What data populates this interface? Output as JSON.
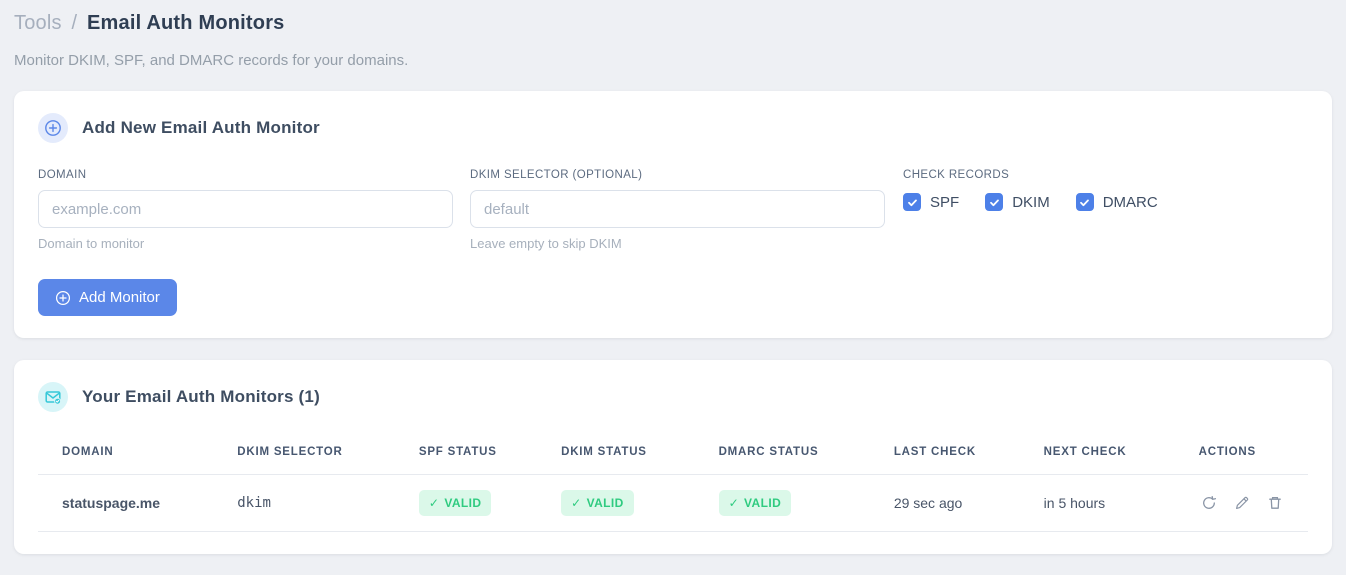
{
  "breadcrumb": {
    "section": "Tools",
    "separator": "/",
    "page": "Email Auth Monitors"
  },
  "subtitle": "Monitor DKIM, SPF, and DMARC records for your domains.",
  "icons": {
    "check_glyph": "✓",
    "header_icon_add": "plus-circle-icon",
    "header_icon_monitors": "mail-check-icon",
    "action_icons": [
      "refresh-icon",
      "edit-pencil-icon",
      "trash-icon"
    ]
  },
  "colors": {
    "accent_blue": "#5b87e8",
    "checkbox_blue": "#4d80e8",
    "badge_green_bg": "#dbf8e9",
    "badge_green_text": "#2fcb80",
    "code_pink": "#e8427c",
    "teal_icon": "#35c8d8",
    "page_bg": "#eef0f4"
  },
  "add_card": {
    "title": "Add New Email Auth Monitor",
    "fields": {
      "domain": {
        "label": "DOMAIN",
        "placeholder": "example.com",
        "value": "",
        "help": "Domain to monitor"
      },
      "dkim_selector": {
        "label": "DKIM SELECTOR (OPTIONAL)",
        "placeholder": "default",
        "value": "",
        "help": "Leave empty to skip DKIM"
      }
    },
    "check_records": {
      "label": "CHECK RECORDS",
      "options": [
        {
          "label": "SPF",
          "checked": true
        },
        {
          "label": "DKIM",
          "checked": true
        },
        {
          "label": "DMARC",
          "checked": true
        }
      ]
    },
    "submit_label": "Add Monitor"
  },
  "monitors_card": {
    "title": "Your Email Auth Monitors (1)",
    "count": 1,
    "table": {
      "headers": [
        "DOMAIN",
        "DKIM SELECTOR",
        "SPF STATUS",
        "DKIM STATUS",
        "DMARC STATUS",
        "LAST CHECK",
        "NEXT CHECK",
        "ACTIONS"
      ],
      "rows": [
        {
          "domain": "statuspage.me",
          "dkim_selector": "dkim",
          "spf_status": "VALID",
          "dkim_status": "VALID",
          "dmarc_status": "VALID",
          "last_check": "29 sec ago",
          "next_check": "in 5 hours"
        }
      ]
    }
  }
}
